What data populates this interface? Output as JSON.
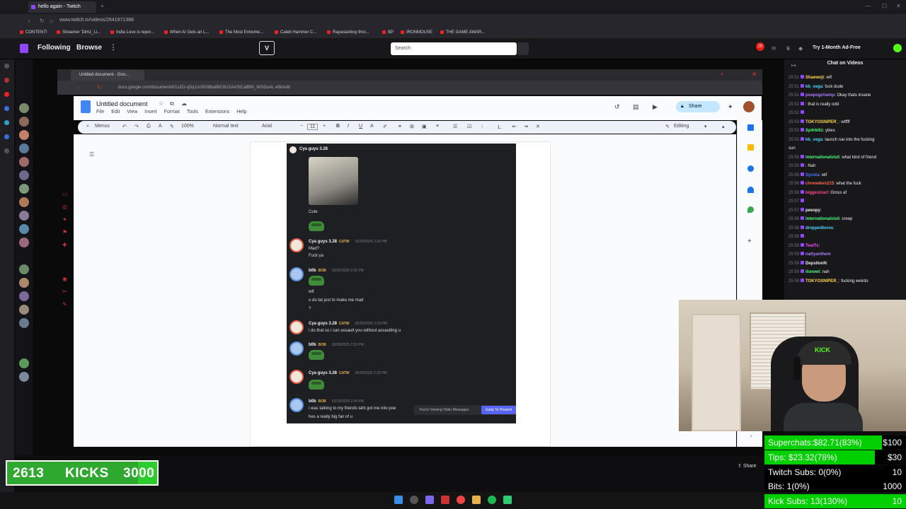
{
  "browser": {
    "tab_title": "hello again - Twitch",
    "url": "www.twitch.tv/videos/2641671388",
    "bookmarks": [
      "CONTENT!",
      "Streamer 'Dimz_Li...",
      "India Love is repor...",
      "When AI Gets an L...",
      "The Most Extreme...",
      "Caleb Hammer C...",
      "Rayasianboy thro...",
      "BP",
      "IRONMOUSE",
      "THE GAME AWAR..."
    ]
  },
  "twitch_nav": {
    "following": "Following",
    "browse": "Browse",
    "search_placeholder": "Search",
    "notification_count": "28",
    "ad_free": "Try 1-Month Ad-Free"
  },
  "inner_browser": {
    "tab_title": "Untitled document - Goo...",
    "url": "docs.google.com/document/d/1sZO-qSq1noSD9lbalBlC6U1AASICalBtN_WGDuAL e8k/edit"
  },
  "docs": {
    "title": "Untitled document",
    "menu": [
      "File",
      "Edit",
      "View",
      "Insert",
      "Format",
      "Tools",
      "Extensions",
      "Help"
    ],
    "share_label": "Share",
    "menus_label": "Menus",
    "zoom": "100%",
    "style": "Normal text",
    "font": "Arial",
    "font_size": "11",
    "mode": "Editing"
  },
  "discord": {
    "top_user": "Cya guys 3.28",
    "messages": [
      {
        "user": "",
        "text": "Cute"
      },
      {
        "user": "Cya guys 3.28",
        "tag": "CATW",
        "time": "02/25/2025 2:26 PM",
        "lines": [
          "Mad?",
          "Fuck ya"
        ]
      },
      {
        "user": "b0b",
        "tag": "BOB",
        "time": "02/25/2025 2:32 PM",
        "lines": [
          "wtf",
          "u do tat just to make me mad",
          "?"
        ]
      },
      {
        "user": "Cya guys 3.28",
        "tag": "CATW",
        "time": "02/25/2025 2:33 PM",
        "lines": [
          "i do that so i can assault you without assaulting u"
        ]
      },
      {
        "user": "b0b",
        "tag": "BOB",
        "time": "02/25/2025 2:33 PM",
        "lines": []
      },
      {
        "user": "Cya guys 3.28",
        "tag": "CATW",
        "time": "02/25/2025 2:33 PM",
        "lines": []
      },
      {
        "user": "b0b",
        "tag": "BOB",
        "time": "02/25/2025 2:34 PM",
        "lines": [
          "i was talking to my friends taht got me into poe",
          "hes a really big fan of u"
        ]
      }
    ],
    "older_messages": "You're Viewing Older Messages",
    "jump_present": "Jump To Present"
  },
  "chat": {
    "header": "Chat on Videos",
    "lines": [
      {
        "time": "25:51",
        "user": "Shaewoji",
        "color": "#ffd84a",
        "text": ": wtf"
      },
      {
        "time": "25:51",
        "user": "kb_vega",
        "color": "#4ad8ff",
        "text": ": fuck dude"
      },
      {
        "time": "25:51",
        "user": "poepogchamp",
        "color": "#b07cff",
        "text": ": Okay thats insane"
      },
      {
        "time": "25:52",
        "user": "",
        "color": "#4a7cff",
        "text": ": that is really odd"
      },
      {
        "time": "25:52",
        "user": "",
        "color": "#ff4a4a",
        "text": ""
      },
      {
        "time": "25:53",
        "user": "TOKYOSNIPER_",
        "color": "#ffd84a",
        "text": ": wtffff"
      },
      {
        "time": "25:53",
        "user": "Sp4rkillz",
        "color": "#4aff7c",
        "text": ": yikes"
      },
      {
        "time": "25:53",
        "user": "kb_vega",
        "color": "#4ad8ff",
        "text": ": launch rue into the fucking"
      },
      {
        "time": "",
        "user": "",
        "color": "#efeff1",
        "text": "sun"
      },
      {
        "time": "25:55",
        "user": "internationalvisit",
        "color": "#4aff7c",
        "text": ": what kind of friend"
      },
      {
        "time": "25:55",
        "user": "",
        "color": "#ff4a4a",
        "text": ": Nah"
      },
      {
        "time": "25:56",
        "user": "Syxsta",
        "color": "#4a7cff",
        "text": ": wtf"
      },
      {
        "time": "25:56",
        "user": "chreneken215",
        "color": "#ff6a4a",
        "text": ": what the fuck"
      },
      {
        "time": "25:56",
        "user": "biggestcarl",
        "color": "#ff4a8c",
        "text": ": Gross af"
      },
      {
        "time": "25:57",
        "user": "",
        "color": "#4a7cff",
        "text": ""
      },
      {
        "time": "25:57",
        "user": "peeopy",
        "color": "#efeff1",
        "text": ":"
      },
      {
        "time": "25:58",
        "user": "internationalvisit",
        "color": "#4aff7c",
        "text": ": creep"
      },
      {
        "time": "25:58",
        "user": "droppedtoros",
        "color": "#4ad8ff",
        "text": ":"
      },
      {
        "time": "25:58",
        "user": "",
        "color": "#ff4a4a",
        "text": ""
      },
      {
        "time": "25:59",
        "user": "TestTs",
        "color": "#ff4aff",
        "text": ":"
      },
      {
        "time": "25:59",
        "user": "nattyanthem",
        "color": "#b07cff",
        "text": ""
      },
      {
        "time": "25:59",
        "user": "DepsilonN",
        "color": "#efeff1",
        "text": ":"
      },
      {
        "time": "25:59",
        "user": "ilsnowi",
        "color": "#4aff7c",
        "text": ": nah"
      },
      {
        "time": "25:59",
        "user": "TOKYOSNIPER_",
        "color": "#ffd84a",
        "text": ": fucking weirdo"
      }
    ]
  },
  "stats": {
    "rows": [
      {
        "label": "Superchats:$82.71(83%)",
        "goal": "$100",
        "fill": 0.83
      },
      {
        "label": "Tips: $23.32(78%)",
        "goal": "$30",
        "fill": 0.78
      },
      {
        "label": "Twitch Subs: 0(0%)",
        "goal": "10",
        "fill": 0
      },
      {
        "label": "Bits: 1(0%)",
        "goal": "1000",
        "fill": 0
      },
      {
        "label": "Kick Subs: 13(130%)",
        "goal": "10",
        "fill": 1
      }
    ]
  },
  "kicks": {
    "current": "2613",
    "label": "KICKS",
    "goal": "3000",
    "progress": 0.871
  },
  "webcam": {
    "cap_text": "KICK"
  },
  "video": {
    "share_label": "Share"
  }
}
